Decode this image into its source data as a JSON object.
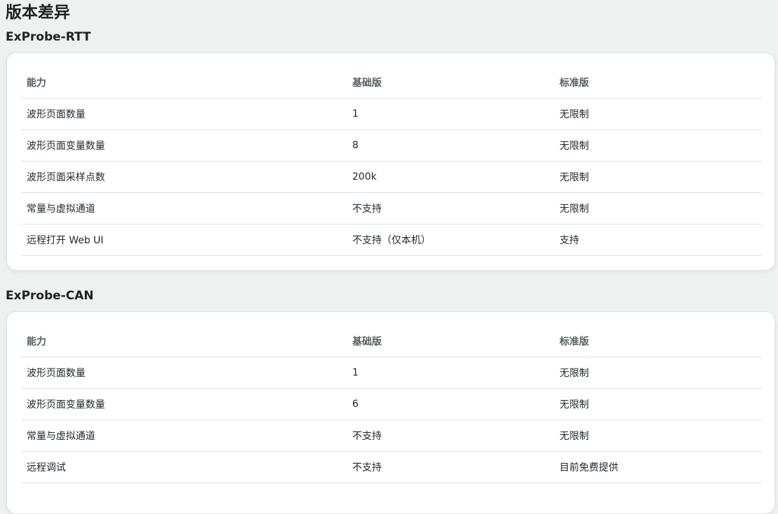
{
  "page_title": "版本差异",
  "sections": [
    {
      "title": "ExProbe-RTT",
      "headers": [
        "能力",
        "基础版",
        "标准版"
      ],
      "rows": [
        [
          "波形页面数量",
          "1",
          "无限制"
        ],
        [
          "波形页面变量数量",
          "8",
          "无限制"
        ],
        [
          "波形页面采样点数",
          "200k",
          "无限制"
        ],
        [
          "常量与虚拟通道",
          "不支持",
          "无限制"
        ],
        [
          "远程打开 Web UI",
          "不支持（仅本机）",
          "支持"
        ]
      ]
    },
    {
      "title": "ExProbe-CAN",
      "headers": [
        "能力",
        "基础版",
        "标准版"
      ],
      "rows": [
        [
          "波形页面数量",
          "1",
          "无限制"
        ],
        [
          "波形页面变量数量",
          "6",
          "无限制"
        ],
        [
          "常量与虚拟通道",
          "不支持",
          "无限制"
        ],
        [
          "远程调试",
          "不支持",
          "目前免费提供"
        ]
      ]
    }
  ]
}
